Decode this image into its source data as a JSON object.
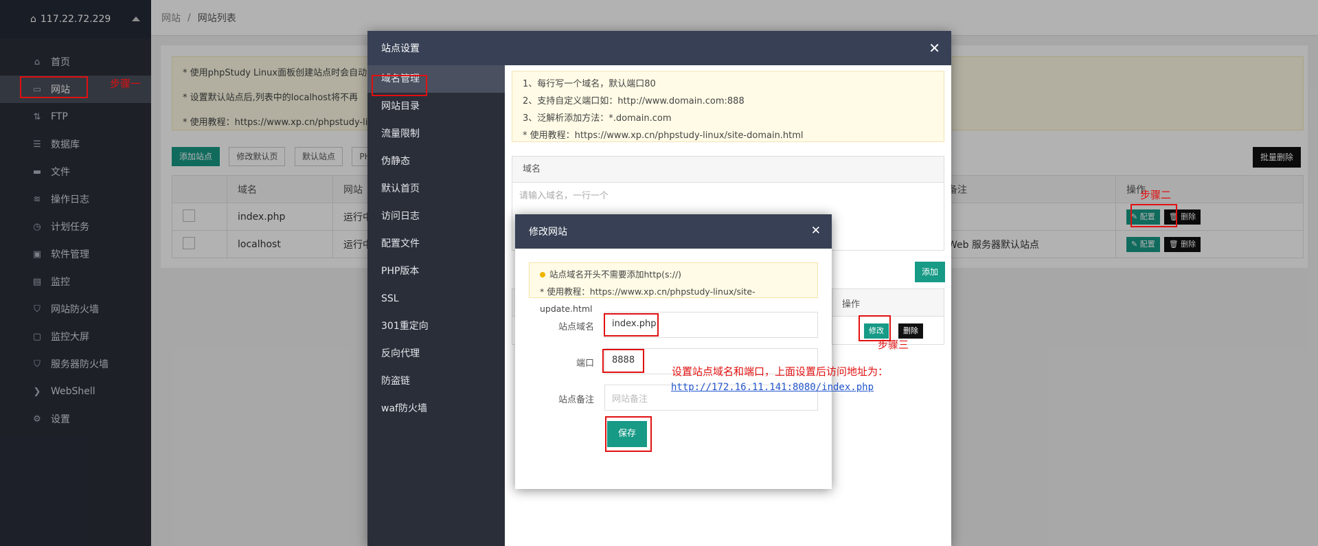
{
  "sidebar": {
    "host": "117.22.72.229",
    "items": [
      {
        "label": "首页",
        "icon": "home-icon"
      },
      {
        "label": "网站",
        "icon": "monitor-icon"
      },
      {
        "label": "FTP",
        "icon": "ftp-icon"
      },
      {
        "label": "数据库",
        "icon": "database-icon"
      },
      {
        "label": "文件",
        "icon": "folder-icon"
      },
      {
        "label": "操作日志",
        "icon": "log-icon"
      },
      {
        "label": "计划任务",
        "icon": "clock-icon"
      },
      {
        "label": "软件管理",
        "icon": "software-icon"
      },
      {
        "label": "监控",
        "icon": "chart-icon"
      },
      {
        "label": "网站防火墙",
        "icon": "shield-icon"
      },
      {
        "label": "监控大屏",
        "icon": "screen-icon"
      },
      {
        "label": "服务器防火墙",
        "icon": "shield-icon"
      },
      {
        "label": "WebShell",
        "icon": "terminal-icon"
      },
      {
        "label": "设置",
        "icon": "gear-icon"
      }
    ]
  },
  "breadcrumb": {
    "root": "网站",
    "sep": "/",
    "current": "网站列表"
  },
  "notice": [
    "* 使用phpStudy Linux面板创建站点时会自动",
    "* 设置默认站点后,列表中的localhost将不再",
    "* 使用教程：https://www.xp.cn/phpstudy-linu"
  ],
  "toolbar": {
    "add": "添加站点",
    "edit_default": "修改默认页",
    "default_site": "默认站点",
    "more": "PH",
    "batch_delete": "批量删除"
  },
  "table": {
    "headers": [
      "",
      "域名",
      "网站",
      "备注",
      "操作"
    ],
    "rows": [
      {
        "domain": "index.php",
        "status": "运行中",
        "remark": ""
      },
      {
        "domain": "localhost",
        "status": "运行中",
        "remark": "Web 服务器默认站点"
      }
    ],
    "config": "✎ 配置",
    "delete": "🗑 删除"
  },
  "site_dialog": {
    "title": "站点设置",
    "close": "✕",
    "nav": [
      "域名管理",
      "网站目录",
      "流量限制",
      "伪静态",
      "默认首页",
      "访问日志",
      "配置文件",
      "PHP版本",
      "SSL",
      "301重定向",
      "反向代理",
      "防盗链",
      "waf防火墙"
    ],
    "hints": [
      "1、每行写一个域名，默认端口80",
      "2、支持自定义端口如：http://www.domain.com:888",
      "3、泛解析添加方法：*.domain.com",
      "* 使用教程：https://www.xp.cn/phpstudy-linux/site-domain.html"
    ],
    "domain_header": "域名",
    "domain_placeholder": "请输入域名，一行一个",
    "add": "添加",
    "op_header": "操作",
    "edit": "修改",
    "delete": "删除"
  },
  "edit_dialog": {
    "title": "修改网站",
    "close": "✕",
    "warn1": "站点域名开头不需要添加http(s://)",
    "warn2": "* 使用教程：https://www.xp.cn/phpstudy-linux/site-update.html",
    "domain_label": "站点域名",
    "domain_value": "index.php",
    "port_label": "端口",
    "port_value": "8888",
    "remark_label": "站点备注",
    "remark_placeholder": "网站备注",
    "save": "保存"
  },
  "annotations": {
    "step1": "步骤一",
    "step2": "步骤二",
    "step3": "步骤三",
    "note": "设置站点域名和端口，上面设置后访问地址为：",
    "url": "http://172.16.11.141:8080/index.php"
  },
  "colors": {
    "accent": "#179a86",
    "sidebar": "#2a2e39",
    "dialog_header": "#374055",
    "annotation": "#e01010"
  }
}
